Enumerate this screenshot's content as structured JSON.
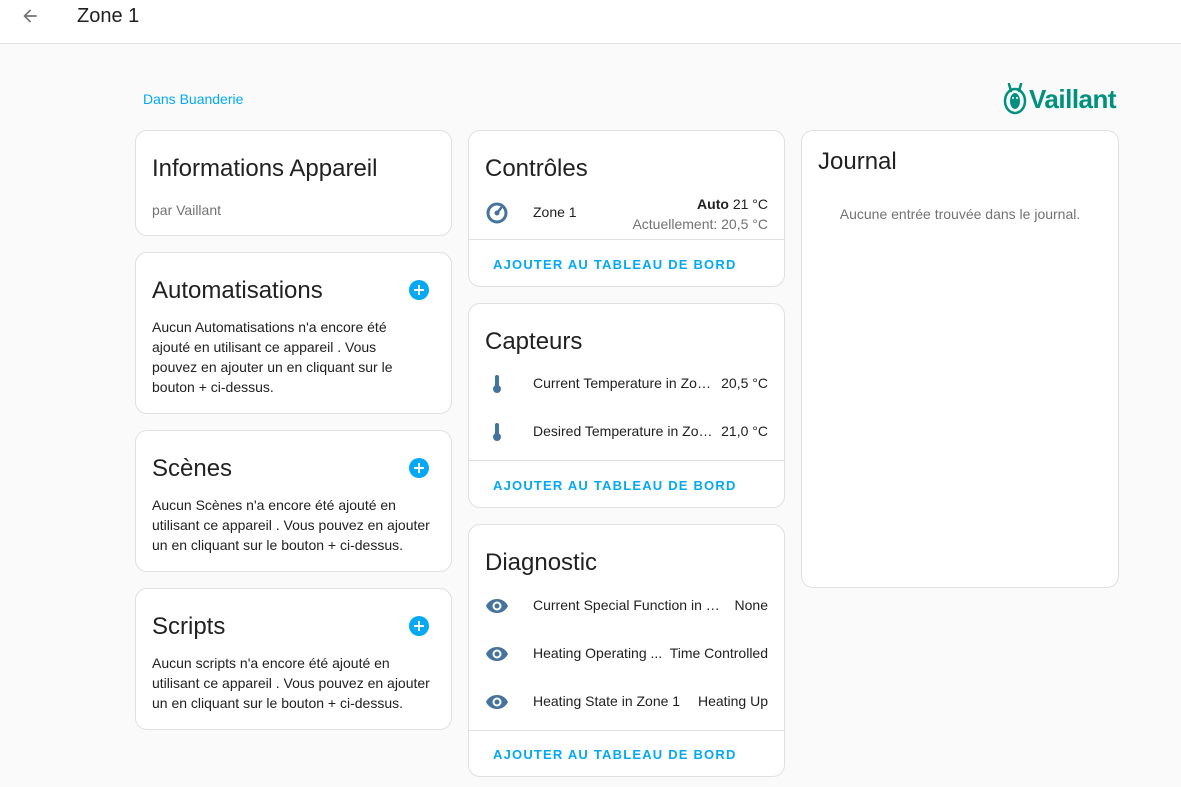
{
  "header": {
    "title": "Zone 1"
  },
  "area_link": "Dans Buanderie",
  "brand": {
    "name": "Vaillant",
    "color": "#00917e"
  },
  "info_card": {
    "title": "Informations Appareil",
    "subtitle": "par Vaillant"
  },
  "automations_card": {
    "title": "Automatisations",
    "text": "Aucun Automatisations n'a encore été ajouté en utilisant ce appareil . Vous pouvez en ajouter un en cliquant sur le bouton + ci-dessus."
  },
  "scenes_card": {
    "title": "Scènes",
    "text": "Aucun Scènes n'a encore été ajouté en utilisant ce appareil . Vous pouvez en ajouter un en cliquant sur le bouton + ci-dessus."
  },
  "scripts_card": {
    "title": "Scripts",
    "text": "Aucun scripts n'a encore été ajouté en utilisant ce appareil . Vous pouvez en ajouter un en cliquant sur le bouton + ci-dessus."
  },
  "controls_card": {
    "title": "Contrôles",
    "entity": {
      "name": "Zone 1",
      "mode": "Auto",
      "target": "21 °C",
      "current": "Actuellement: 20,5 °C",
      "icon": "thermostat-icon"
    },
    "action": "AJOUTER AU TABLEAU DE BORD"
  },
  "sensors_card": {
    "title": "Capteurs",
    "rows": [
      {
        "name": "Current Temperature in Zon...",
        "value": "20,5 °C",
        "icon": "thermometer-icon"
      },
      {
        "name": "Desired Temperature in Zon...",
        "value": "21,0 °C",
        "icon": "thermometer-icon"
      }
    ],
    "action": "AJOUTER AU TABLEAU DE BORD"
  },
  "diagnostic_card": {
    "title": "Diagnostic",
    "rows": [
      {
        "name": "Current Special Function in Z...",
        "value": "None",
        "icon": "eye-icon"
      },
      {
        "name": "Heating Operating ...",
        "value": "Time Controlled",
        "icon": "eye-icon"
      },
      {
        "name": "Heating State in Zone 1",
        "value": "Heating Up",
        "icon": "eye-icon"
      }
    ],
    "action": "AJOUTER AU TABLEAU DE BORD"
  },
  "logbook_card": {
    "title": "Journal",
    "empty_text": "Aucune entrée trouvée dans le journal."
  },
  "colors": {
    "accent": "#03a9f4",
    "icon": "#44739e",
    "background": "#fafafa"
  }
}
